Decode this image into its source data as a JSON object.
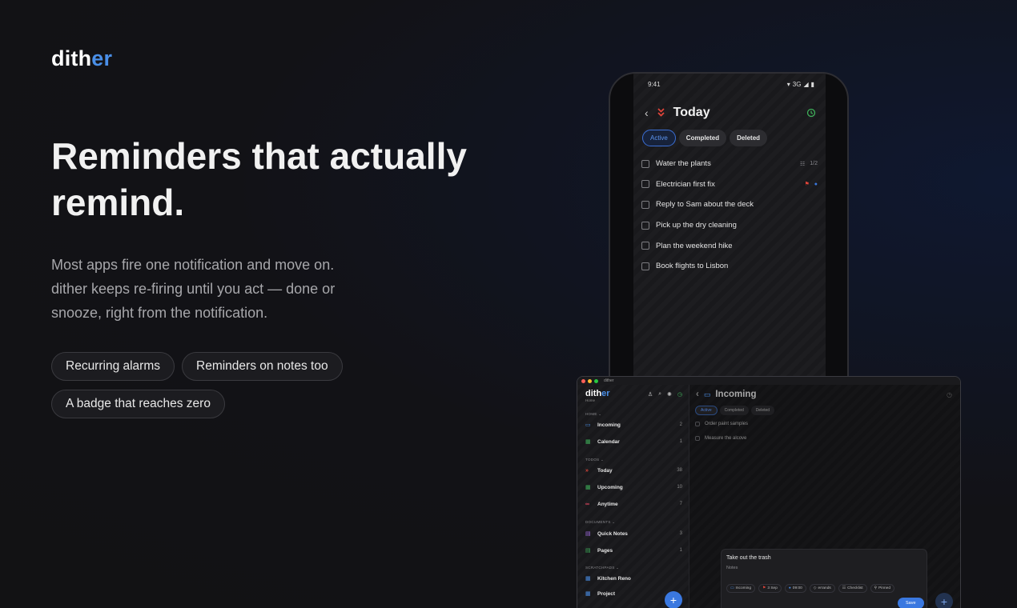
{
  "brand": {
    "logo_part1": "dith",
    "logo_part2": "er",
    "accent": "#4a8fe8"
  },
  "hero": {
    "headline": "Reminders that actually remind.",
    "subtext": "Most apps fire one notification and move on. dither keeps re-firing until you act — done or snooze, right from the notification.",
    "pills": [
      "Recurring alarms",
      "Reminders on notes too",
      "A badge that reaches zero"
    ]
  },
  "phone": {
    "time": "9:41",
    "network": "3G",
    "title": "Today",
    "tabs": [
      "Active",
      "Completed",
      "Deleted"
    ],
    "tasks": [
      {
        "text": "Water the plants",
        "meta": "1/2"
      },
      {
        "text": "Electrician first fix",
        "meta": ""
      },
      {
        "text": "Reply to Sam about the deck",
        "meta": ""
      },
      {
        "text": "Pick up the dry cleaning",
        "meta": ""
      },
      {
        "text": "Plan the weekend hike",
        "meta": ""
      },
      {
        "text": "Book flights to Lisbon",
        "meta": ""
      }
    ]
  },
  "desktop": {
    "window_title": "dither",
    "sidebar": {
      "logo_part1": "dith",
      "logo_part2": "er",
      "logo_sub": "Home",
      "sections": [
        "HOME ⌄",
        "TODOS ⌄",
        "DOCUMENTS ⌄",
        "SCRATCHPADS ⌄"
      ],
      "items": [
        {
          "label": "Incoming",
          "count": "2"
        },
        {
          "label": "Calendar",
          "count": "1"
        },
        {
          "label": "Today",
          "count": "38"
        },
        {
          "label": "Upcoming",
          "count": "10"
        },
        {
          "label": "Anytime",
          "count": "7"
        },
        {
          "label": "Quick Notes",
          "count": "3"
        },
        {
          "label": "Pages",
          "count": "1"
        },
        {
          "label": "Kitchen Reno",
          "count": ""
        },
        {
          "label": "Project",
          "count": ""
        }
      ]
    },
    "main": {
      "title": "Incoming",
      "tabs": [
        "Active",
        "Completed",
        "Deleted"
      ],
      "items": [
        "Order paint samples",
        "Measure the alcove"
      ]
    },
    "card": {
      "title": "Take out the trash",
      "notes": "Notes",
      "chips": [
        "Incoming",
        "3 Sep",
        "09:00",
        "errands",
        "Checklist",
        "Pinned"
      ],
      "save": "Save"
    }
  }
}
